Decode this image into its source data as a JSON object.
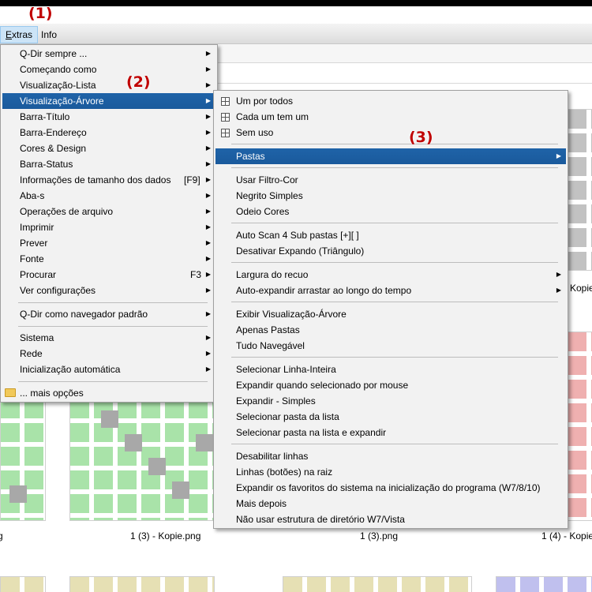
{
  "callouts": [
    "(1)",
    "(2)",
    "(3)"
  ],
  "menubar": {
    "items": [
      "Extras",
      "Info"
    ]
  },
  "files": {
    "labels": [
      "g",
      "1 (3) - Kopie.png",
      "1 (3).png",
      "1 (4) - Kopie",
      "Kopie"
    ]
  },
  "extras_menu": {
    "items": [
      {
        "label": "Q-Dir sempre ...",
        "submenu": true
      },
      {
        "label": "Começando como",
        "submenu": true
      },
      {
        "label": "Visualização-Lista",
        "submenu": true
      },
      {
        "label": "Visualização-Árvore",
        "submenu": true,
        "selected": true
      },
      {
        "label": "Barra-Título",
        "submenu": true
      },
      {
        "label": "Barra-Endereço",
        "submenu": true
      },
      {
        "label": "Cores & Design",
        "submenu": true
      },
      {
        "label": "Barra-Status",
        "submenu": true
      },
      {
        "label": "Informações de tamanho dos dados",
        "shortcut": "[F9]",
        "submenu": true
      },
      {
        "label": "Aba-s",
        "submenu": true
      },
      {
        "label": "Operações de arquivo",
        "submenu": true
      },
      {
        "label": "Imprimir",
        "submenu": true
      },
      {
        "label": "Prever",
        "submenu": true
      },
      {
        "label": "Fonte",
        "submenu": true
      },
      {
        "label": "Procurar",
        "shortcut": "F3",
        "submenu": true
      },
      {
        "label": "Ver configurações",
        "submenu": true
      },
      {
        "label": "Q-Dir como navegador padrão",
        "submenu": true
      },
      {
        "label": "Sistema",
        "submenu": true
      },
      {
        "label": "Rede",
        "submenu": true
      },
      {
        "label": "Inicialização automática",
        "submenu": true
      },
      {
        "label": "... mais opções",
        "icon": "folder-icon"
      }
    ]
  },
  "tree_menu": {
    "items": [
      {
        "label": "Um por todos",
        "icon": "grid-icon"
      },
      {
        "label": "Cada um tem um",
        "icon": "grid-icon"
      },
      {
        "label": "Sem uso",
        "icon": "grid-icon"
      },
      {
        "label": "Pastas",
        "submenu": true,
        "selected": true
      },
      {
        "label": "Usar Filtro-Cor"
      },
      {
        "label": "Negrito Simples"
      },
      {
        "label": "Odeio Cores"
      },
      {
        "label": "Auto Scan 4 Sub pastas [+][ ]"
      },
      {
        "label": "Desativar Expando (Triângulo)"
      },
      {
        "label": "Largura do recuo",
        "submenu": true
      },
      {
        "label": "Auto-expandir arrastar ao longo do tempo",
        "submenu": true
      },
      {
        "label": "Exibir Visualização-Árvore"
      },
      {
        "label": "Apenas Pastas"
      },
      {
        "label": "Tudo Navegável"
      },
      {
        "label": "Selecionar Linha-Inteira"
      },
      {
        "label": "Expandir quando selecionado por mouse"
      },
      {
        "label": "Expandir - Simples"
      },
      {
        "label": "Selecionar pasta da lista"
      },
      {
        "label": "Selecionar pasta na lista e expandir"
      },
      {
        "label": "Desabilitar linhas"
      },
      {
        "label": "Linhas (botões) na raiz"
      },
      {
        "label": "Expandir os favoritos do sistema na inicialização do programa (W7/8/10)"
      },
      {
        "label": "Mais depois"
      },
      {
        "label": "Não usar estrutura de diretório W7/Vista"
      }
    ]
  },
  "colors": {
    "selection": "#1f63a8",
    "callout": "#c00000",
    "menu_bg": "#f2f2f2"
  }
}
